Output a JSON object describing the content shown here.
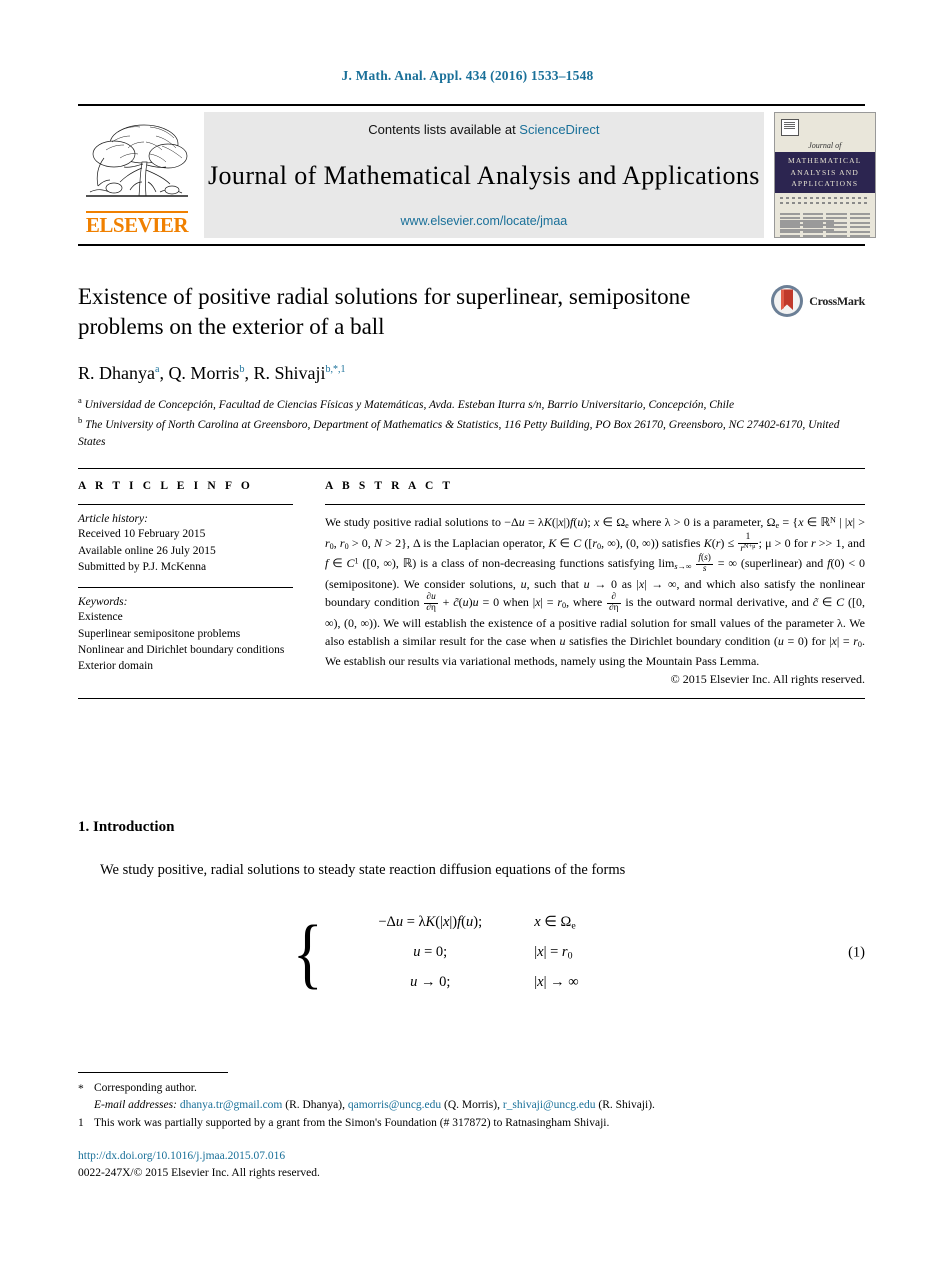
{
  "running_head": "J. Math. Anal. Appl. 434 (2016) 1533–1548",
  "masthead": {
    "publisher": "ELSEVIER",
    "contents_prefix": "Contents lists available at ",
    "contents_link": "ScienceDirect",
    "journal_name": "Journal of Mathematical Analysis and Applications",
    "journal_url": "www.elsevier.com/locate/jmaa",
    "cover": {
      "script_line": "Journal of",
      "band_line1": "MATHEMATICAL",
      "band_line2": "ANALYSIS AND",
      "band_line3": "APPLICATIONS"
    }
  },
  "article": {
    "title": "Existence of positive radial solutions for superlinear, semipositone problems on the exterior of a ball",
    "crossmark_label": "CrossMark",
    "authors": [
      {
        "name": "R. Dhanya",
        "marks": "a"
      },
      {
        "name": "Q. Morris",
        "marks": "b"
      },
      {
        "name": "R. Shivaji",
        "marks": "b,*,1"
      }
    ],
    "authors_plain": "R. Dhanya a, Q. Morris b, R. Shivaji b,*,1",
    "affiliations": [
      {
        "mark": "a",
        "text": "Universidad de Concepción, Facultad de Ciencias Físicas y Matemáticas, Avda. Esteban Iturra s/n, Barrio Universitario, Concepción, Chile"
      },
      {
        "mark": "b",
        "text": "The University of North Carolina at Greensboro, Department of Mathematics & Statistics, 116 Petty Building, PO Box 26170, Greensboro, NC 27402-6170, United States"
      }
    ]
  },
  "article_info": {
    "heading": "A R T I C L E    I N F O",
    "history_label": "Article history:",
    "history": [
      "Received 10 February 2015",
      "Available online 26 July 2015",
      "Submitted by P.J. McKenna"
    ],
    "keywords_label": "Keywords:",
    "keywords": [
      "Existence",
      "Superlinear semipositone problems",
      "Nonlinear and Dirichlet boundary conditions",
      "Exterior domain"
    ]
  },
  "abstract": {
    "heading": "A B S T R A C T",
    "copyright": "© 2015 Elsevier Inc. All rights reserved."
  },
  "introduction": {
    "heading": "1.  Introduction",
    "paragraph": "We study positive, radial solutions to steady state reaction diffusion equations of the forms",
    "equation_number": "(1)"
  },
  "footnotes": {
    "corresponding": "Corresponding author.",
    "corresponding_marker": "*",
    "email_label": "E-mail addresses:",
    "emails": [
      {
        "address": "dhanya.tr@gmail.com",
        "owner": "(R. Dhanya)"
      },
      {
        "address": "qamorris@uncg.edu",
        "owner": "(Q. Morris)"
      },
      {
        "address": "r_shivaji@uncg.edu",
        "owner": "(R. Shivaji)."
      }
    ],
    "grant_marker": "1",
    "grant": "This work was partially supported by a grant from the Simon's Foundation (# 317872) to Ratnasingham Shivaji."
  },
  "footer": {
    "doi": "http://dx.doi.org/10.1016/j.jmaa.2015.07.016",
    "issn": "0022-247X/© 2015 Elsevier Inc. All rights reserved."
  },
  "colors": {
    "link": "#1a7099",
    "elsevier_orange": "#f08000",
    "cover_band": "#2c2550",
    "banner_bg": "#e8e8e8"
  }
}
